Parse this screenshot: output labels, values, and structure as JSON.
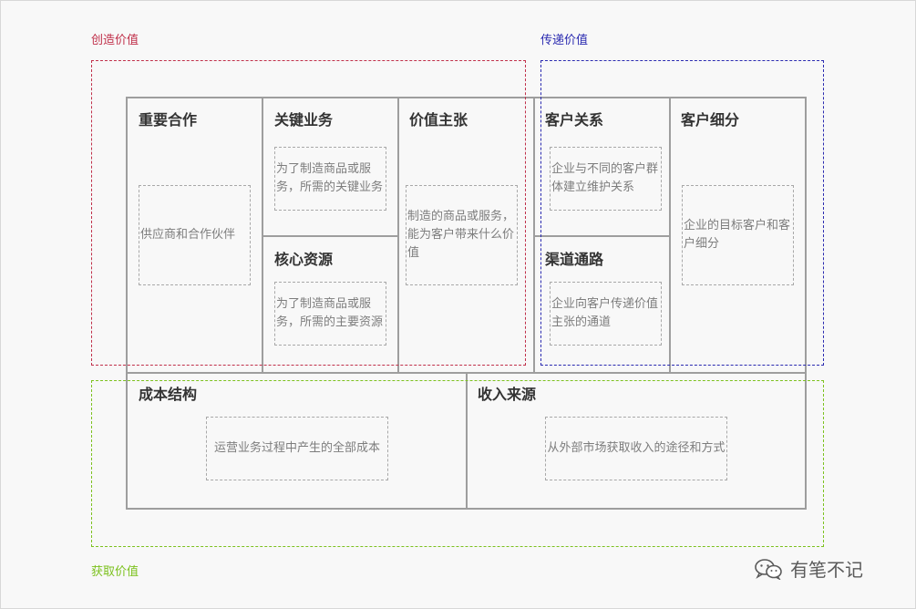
{
  "regions": {
    "create": {
      "label": "创造价值",
      "color": "#c0304a"
    },
    "deliver": {
      "label": "传递价值",
      "color": "#2a2ab0"
    },
    "capture": {
      "label": "获取价值",
      "color": "#7cc11e"
    }
  },
  "canvas": {
    "key_partners": {
      "title": "重要合作",
      "note": "供应商和合作伙伴"
    },
    "key_activities": {
      "title": "关键业务",
      "note": "为了制造商品或服务，所需的关键业务"
    },
    "key_resources": {
      "title": "核心资源",
      "note": "为了制造商品或服务，所需的主要资源"
    },
    "value_propositions": {
      "title": "价值主张",
      "note": "制造的商品或服务，能为客户带来什么价值"
    },
    "customer_relationships": {
      "title": "客户关系",
      "note": "企业与不同的客户群体建立维护关系"
    },
    "channels": {
      "title": "渠道通路",
      "note": "企业向客户传递价值主张的通道"
    },
    "customer_segments": {
      "title": "客户细分",
      "note": "企业的目标客户和客户细分"
    },
    "cost_structure": {
      "title": "成本结构",
      "note": "运营业务过程中产生的全部成本"
    },
    "revenue_streams": {
      "title": "收入来源",
      "note": "从外部市场获取收入的途径和方式"
    }
  },
  "watermark": {
    "icon": "wechat-icon",
    "text": "有笔不记"
  },
  "colors": {
    "cell_border": "#9e9e9e",
    "note_text": "#7d7d7d",
    "background": "#f8f8f8"
  }
}
